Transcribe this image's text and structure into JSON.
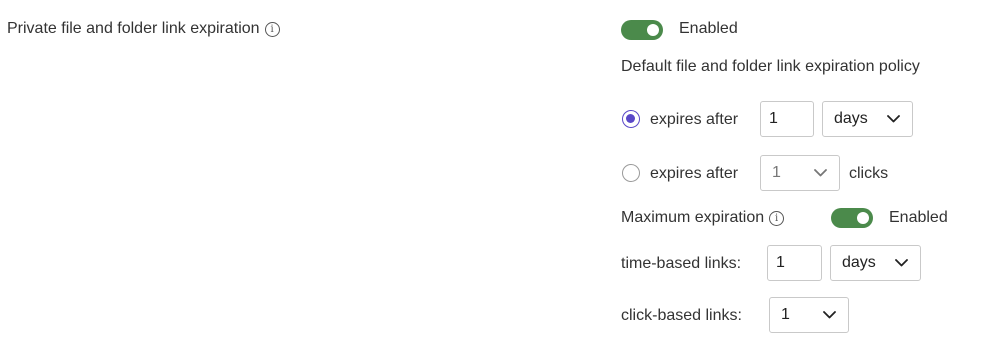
{
  "setting": {
    "title": "Private file and folder link expiration",
    "info_glyph": "i",
    "toggle_state": "Enabled"
  },
  "default_policy": {
    "heading": "Default file and folder link expiration policy",
    "time_option": {
      "label": "expires after",
      "selected": true,
      "value": "1",
      "unit_selected": "days"
    },
    "click_option": {
      "label": "expires after",
      "selected": false,
      "value": "1",
      "suffix": "clicks"
    }
  },
  "maximum": {
    "label": "Maximum expiration",
    "info_glyph": "i",
    "toggle_state": "Enabled",
    "time_based": {
      "label": "time-based links:",
      "value": "1",
      "unit_selected": "days"
    },
    "click_based": {
      "label": "click-based links:",
      "value": "1"
    }
  },
  "colors": {
    "toggle_on": "#4b8a4b",
    "radio_accent": "#5a48c8"
  }
}
